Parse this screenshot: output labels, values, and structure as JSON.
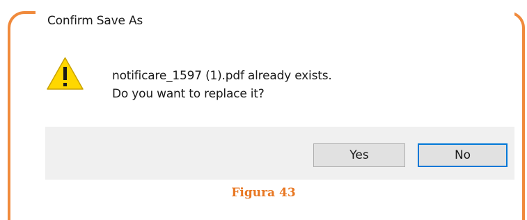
{
  "dialog": {
    "title": "Confirm Save As",
    "icon": "warning-icon",
    "message_line1": "notificare_1597 (1).pdf already exists.",
    "message_line2": "Do you want to replace it?",
    "buttons": {
      "yes_label": "Yes",
      "no_label": "No"
    }
  },
  "caption": "Figura 43",
  "colors": {
    "frame": "#F08A3C",
    "caption": "#E87722",
    "warning_fill": "#FFD700",
    "default_button_border": "#0078D7",
    "button_bar": "#F0F0F0"
  }
}
